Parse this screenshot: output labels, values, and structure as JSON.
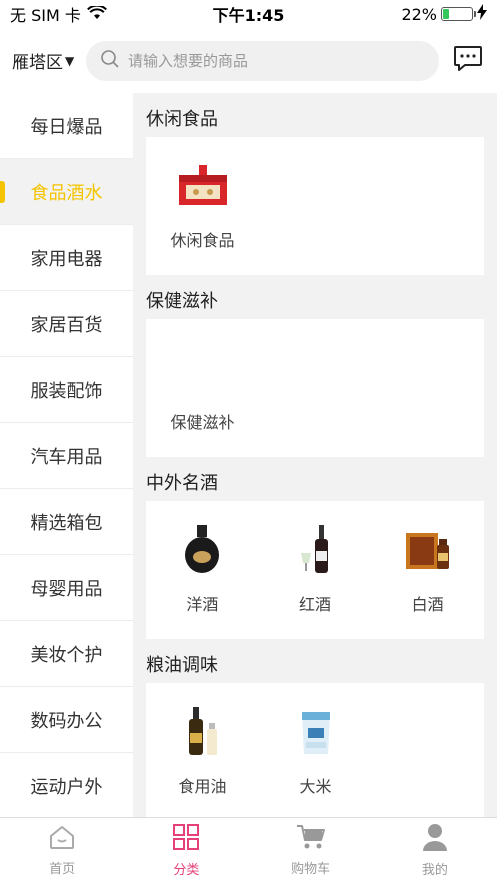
{
  "status_bar": {
    "carrier": "无 SIM 卡",
    "time": "下午1:45",
    "battery": "22%",
    "battery_level": 0.22
  },
  "header": {
    "district": "雁塔区",
    "search_placeholder": "请输入想要的商品"
  },
  "sidebar": {
    "items": [
      {
        "label": "每日爆品",
        "active": false
      },
      {
        "label": "食品酒水",
        "active": true
      },
      {
        "label": "家用电器",
        "active": false
      },
      {
        "label": "家居百货",
        "active": false
      },
      {
        "label": "服装配饰",
        "active": false
      },
      {
        "label": "汽车用品",
        "active": false
      },
      {
        "label": "精选箱包",
        "active": false
      },
      {
        "label": "母婴用品",
        "active": false
      },
      {
        "label": "美妆个护",
        "active": false
      },
      {
        "label": "数码办公",
        "active": false
      },
      {
        "label": "运动户外",
        "active": false
      }
    ]
  },
  "sections": [
    {
      "title": "休闲食品",
      "products": [
        {
          "name": "休闲食品",
          "icon": "snack-gift-box-icon"
        }
      ]
    },
    {
      "title": "保健滋补",
      "products": [
        {
          "name": "保健滋补",
          "icon": ""
        }
      ]
    },
    {
      "title": "中外名酒",
      "products": [
        {
          "name": "洋酒",
          "icon": "foreign-liquor-bottle-icon"
        },
        {
          "name": "红酒",
          "icon": "red-wine-bottle-icon"
        },
        {
          "name": "白酒",
          "icon": "baijiu-gift-box-icon"
        }
      ]
    },
    {
      "title": "粮油调味",
      "products": [
        {
          "name": "食用油",
          "icon": "cooking-oil-bottle-icon"
        },
        {
          "name": "大米",
          "icon": "rice-bag-icon"
        }
      ]
    }
  ],
  "tabbar": {
    "tabs": [
      {
        "label": "首页",
        "icon": "home-icon",
        "active": false
      },
      {
        "label": "分类",
        "icon": "category-grid-icon",
        "active": true
      },
      {
        "label": "购物车",
        "icon": "cart-icon",
        "active": false
      },
      {
        "label": "我的",
        "icon": "user-icon",
        "active": false
      }
    ]
  },
  "colors": {
    "accent_yellow": "#f5c400",
    "accent_pink": "#e5407a"
  }
}
